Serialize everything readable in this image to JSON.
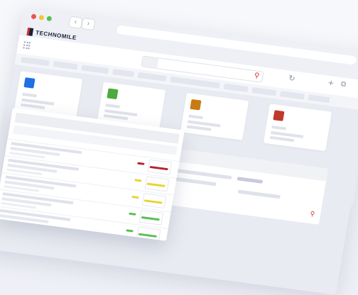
{
  "brand": {
    "logo_text": "TECHNOMILE"
  },
  "browser": {
    "nav_back_icon": "chevron-left-icon",
    "nav_forward_icon": "chevron-right-icon",
    "window_controls": [
      "close",
      "minimize",
      "maximize"
    ]
  },
  "toolbar": {
    "search_icon": "search-icon",
    "refresh_icon": "refresh-icon",
    "new_tab_icon": "plus-icon",
    "copy_icon": "copy-icon"
  },
  "cards": [
    {
      "accent": "#1f6fe5"
    },
    {
      "accent": "#4caa3f"
    },
    {
      "accent": "#c97a12"
    },
    {
      "accent": "#c0392b"
    }
  ],
  "table_rows": [
    {
      "status_color": "#b3262c"
    },
    {
      "status_color": "#e8d434"
    },
    {
      "status_color": "#e8d434"
    },
    {
      "status_color": "#5bbf54"
    },
    {
      "status_color": "#5bbf54"
    }
  ],
  "colors": {
    "accent_red": "#d32f2f",
    "brand_navy": "#1b1f3b"
  }
}
